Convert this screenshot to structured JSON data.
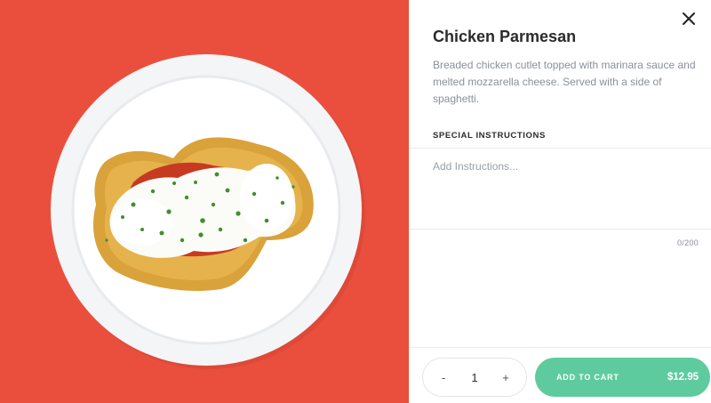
{
  "item": {
    "title": "Chicken Parmesan",
    "description": "Breaded chicken cutlet topped with marinara sauce and melted mozzarella cheese. Served with a side of spaghetti."
  },
  "instructions": {
    "label": "SPECIAL INSTRUCTIONS",
    "placeholder": "Add Instructions...",
    "counter": "0/200"
  },
  "quantity": {
    "decrement": "-",
    "value": "1",
    "increment": "+"
  },
  "cart": {
    "label": "ADD TO CART",
    "price": "$12.95"
  },
  "colors": {
    "photo_background": "#ea4f3e",
    "accent": "#5ecb9e"
  },
  "icons": {
    "close": "close-icon"
  }
}
